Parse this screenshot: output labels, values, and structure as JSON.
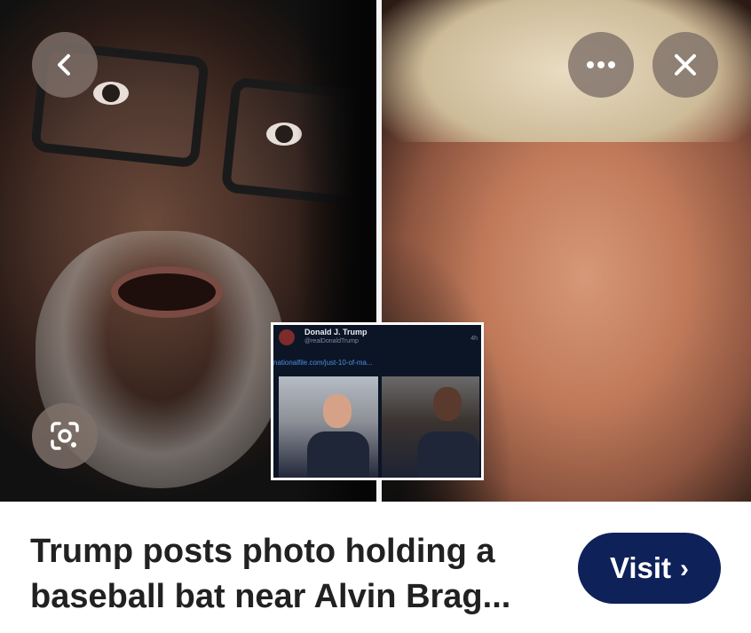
{
  "toolbar": {
    "back_icon": "chevron-left-icon",
    "more_icon": "more-horizontal-icon",
    "close_icon": "close-icon",
    "lens_icon": "visual-search-icon"
  },
  "inset_post": {
    "name": "Donald J. Trump",
    "handle": "@realDonaldTrump",
    "link": "nationalfile.com/just-10-of-ma...",
    "time": "4h"
  },
  "result": {
    "title": "Trump posts photo holding a baseball bat near Alvin Brag...",
    "visit_label": "Visit",
    "visit_chevron": "›"
  },
  "colors": {
    "visit_button": "#0e2159",
    "overlay_button": "#80716a",
    "title_text": "#212121"
  }
}
